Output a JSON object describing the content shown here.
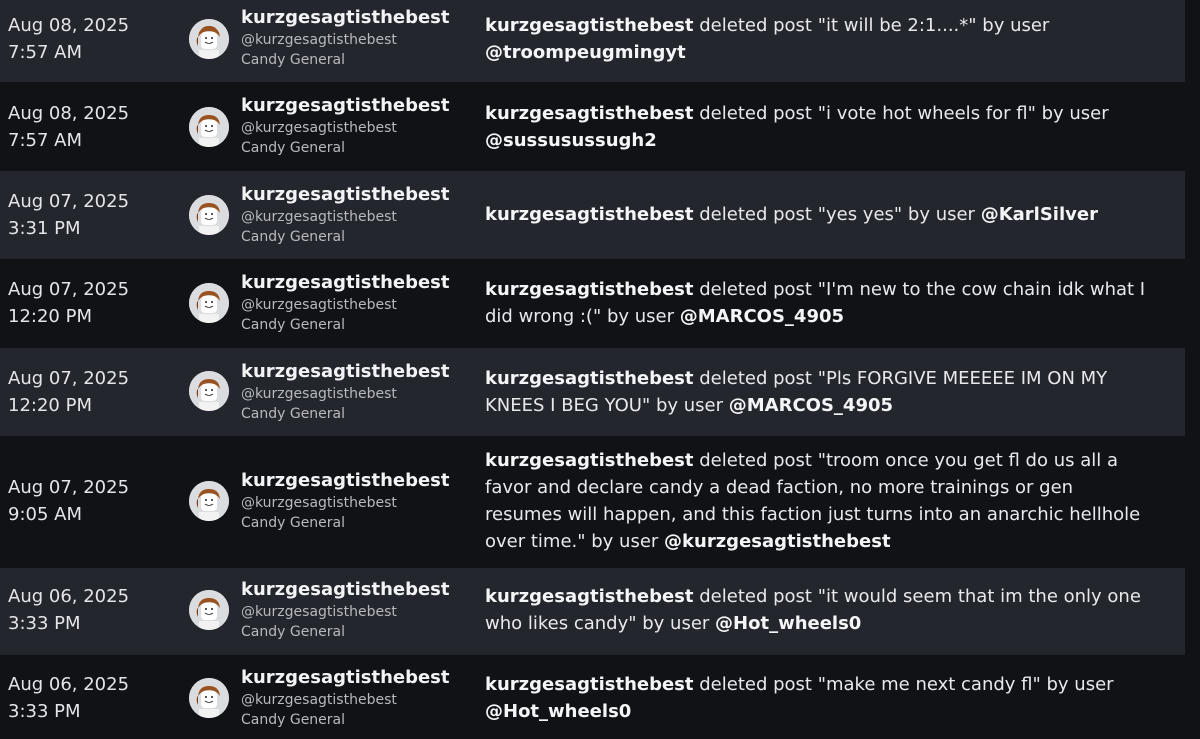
{
  "entries": [
    {
      "date": "Aug 08, 2025",
      "time": "7:57 AM",
      "display_name": "kurzgesagtisthebest",
      "handle": "@kurzgesagtisthebest",
      "role": "Candy General",
      "actor": "kurzgesagtisthebest",
      "action": " deleted post \"it will be 2:1....*\" by user ",
      "target": "@troompeugmingyt"
    },
    {
      "date": "Aug 08, 2025",
      "time": "7:57 AM",
      "display_name": "kurzgesagtisthebest",
      "handle": "@kurzgesagtisthebest",
      "role": "Candy General",
      "actor": "kurzgesagtisthebest",
      "action": " deleted post \"i vote hot wheels for fl\" by user ",
      "target": "@sussusussugh2"
    },
    {
      "date": "Aug 07, 2025",
      "time": "3:31 PM",
      "display_name": "kurzgesagtisthebest",
      "handle": "@kurzgesagtisthebest",
      "role": "Candy General",
      "actor": "kurzgesagtisthebest",
      "action": " deleted post \"yes yes\" by user ",
      "target": "@KarlSilver"
    },
    {
      "date": "Aug 07, 2025",
      "time": "12:20 PM",
      "display_name": "kurzgesagtisthebest",
      "handle": "@kurzgesagtisthebest",
      "role": "Candy General",
      "actor": "kurzgesagtisthebest",
      "action": " deleted post \"I'm new to the cow chain idk what I did wrong :(\" by user ",
      "target": "@MARCOS_4905"
    },
    {
      "date": "Aug 07, 2025",
      "time": "12:20 PM",
      "display_name": "kurzgesagtisthebest",
      "handle": "@kurzgesagtisthebest",
      "role": "Candy General",
      "actor": "kurzgesagtisthebest",
      "action": " deleted post \"Pls FORGIVE MEEEEE IM ON MY KNEES I BEG YOU\" by user ",
      "target": "@MARCOS_4905"
    },
    {
      "date": "Aug 07, 2025",
      "time": "9:05 AM",
      "display_name": "kurzgesagtisthebest",
      "handle": "@kurzgesagtisthebest",
      "role": "Candy General",
      "actor": "kurzgesagtisthebest",
      "action": " deleted post \"troom once you get fl do us all a favor and declare candy a dead faction, no more trainings or gen resumes will happen, and this faction just turns into an anarchic hellhole over time.\" by user ",
      "target": "@kurzgesagtisthebest"
    },
    {
      "date": "Aug 06, 2025",
      "time": "3:33 PM",
      "display_name": "kurzgesagtisthebest",
      "handle": "@kurzgesagtisthebest",
      "role": "Candy General",
      "actor": "kurzgesagtisthebest",
      "action": " deleted post \"it would seem that im the only one who likes candy\" by user ",
      "target": "@Hot_wheels0"
    },
    {
      "date": "Aug 06, 2025",
      "time": "3:33 PM",
      "display_name": "kurzgesagtisthebest",
      "handle": "@kurzgesagtisthebest",
      "role": "Candy General",
      "actor": "kurzgesagtisthebest",
      "action": " deleted post \"make me next candy fl\" by user ",
      "target": "@Hot_wheels0"
    }
  ]
}
